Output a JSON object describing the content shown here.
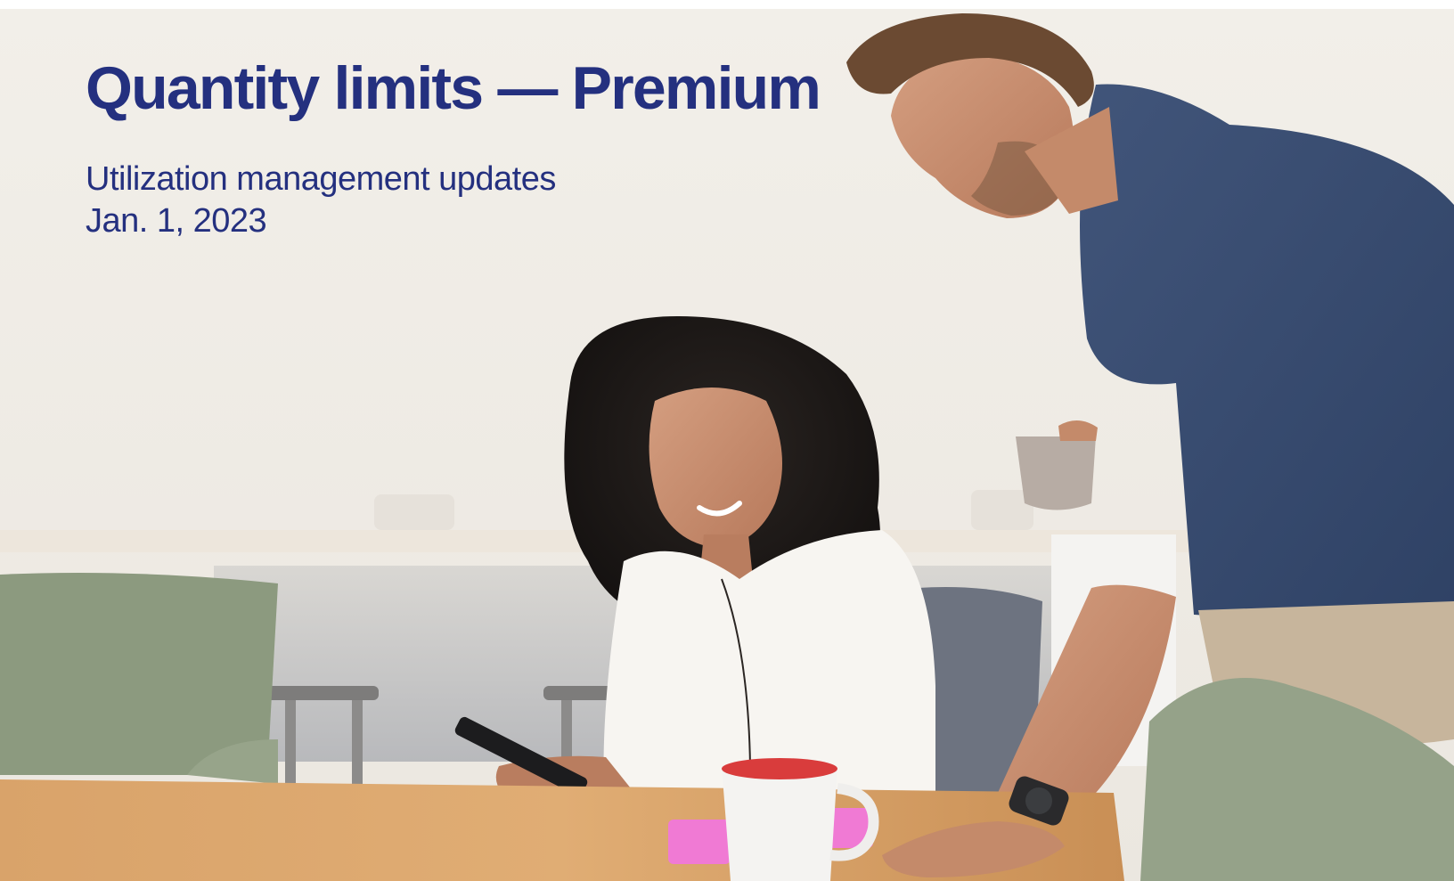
{
  "header": {
    "title": "Quantity limits — Premium",
    "subtitle": "Utilization management updates",
    "date": "Jan. 1, 2023"
  },
  "photo": {
    "subject": "Woman smiling at her phone at a wooden kitchen table while a man with a mug looks on",
    "icon": "photo-image"
  },
  "colors": {
    "brand_navy": "#24307f",
    "background": "#f2efe9"
  }
}
